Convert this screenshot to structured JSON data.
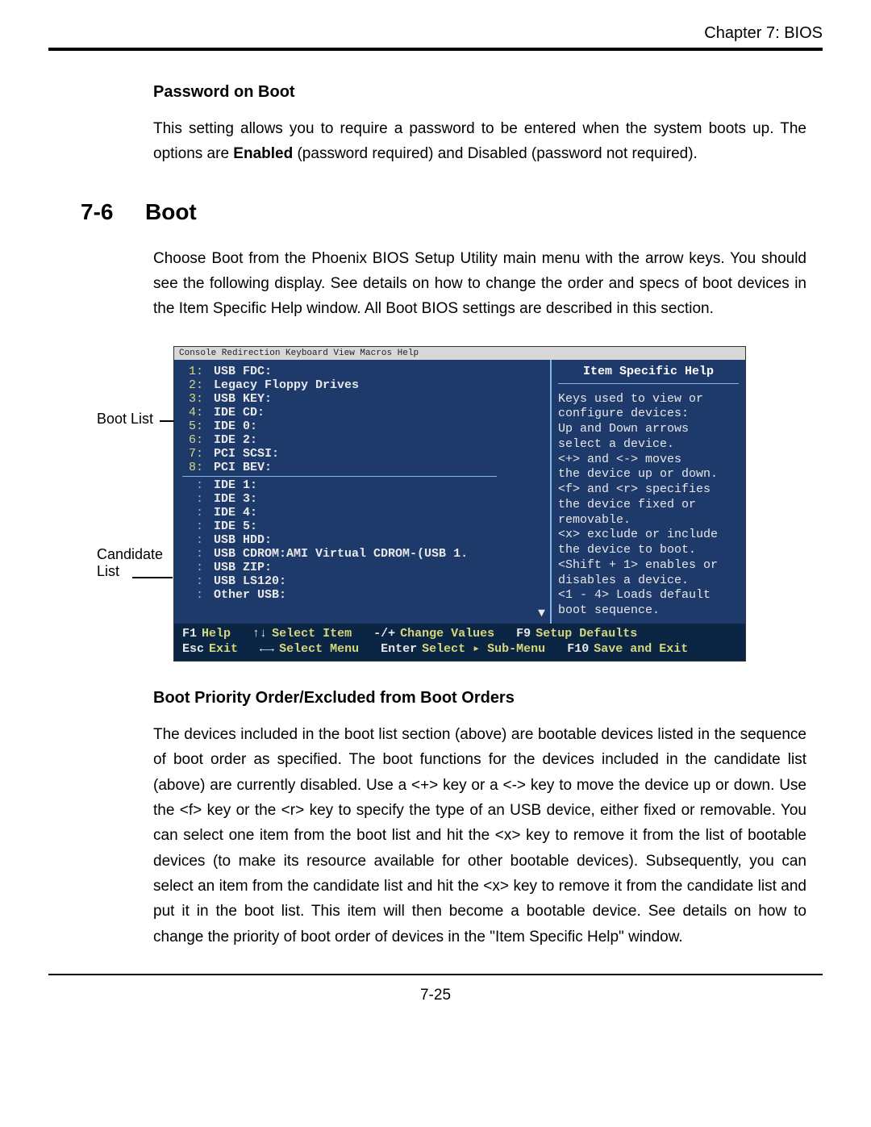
{
  "header": {
    "chapter_line": "Chapter 7: BIOS"
  },
  "sect1": {
    "heading": "Password on Boot",
    "p1a": "This setting allows you to require a password to be entered when the system boots up.  The options are ",
    "bold": "Enabled",
    "p1b": " (password required) and Disabled (password not required)."
  },
  "chapter": {
    "num": "7-6",
    "title": "Boot"
  },
  "intro": {
    "p": "Choose Boot from the Phoenix BIOS Setup Utility main menu with the arrow keys. You should see the following display.  See details on how to change the order and specs of boot devices in the Item Specific Help window.  All Boot BIOS settings are described in this section."
  },
  "labels": {
    "bootlist": "Boot List",
    "candidate_a": "Candidate",
    "candidate_b": "List"
  },
  "bios": {
    "menubar": "Console Redirection   Keyboard   View   Macros   Help",
    "boot_list": [
      {
        "n": "1:",
        "name": "USB FDC:"
      },
      {
        "n": "2:",
        "name": "Legacy Floppy Drives"
      },
      {
        "n": "3:",
        "name": "USB KEY:"
      },
      {
        "n": "4:",
        "name": "IDE CD:"
      },
      {
        "n": "5:",
        "name": "IDE 0:"
      },
      {
        "n": "6:",
        "name": "IDE 2:"
      },
      {
        "n": "7:",
        "name": "PCI SCSI:"
      },
      {
        "n": "8:",
        "name": "PCI BEV:"
      }
    ],
    "candidate_list": [
      {
        "n": ":",
        "name": "IDE 1:"
      },
      {
        "n": ":",
        "name": "IDE 3:"
      },
      {
        "n": ":",
        "name": "IDE 4:"
      },
      {
        "n": ":",
        "name": "IDE 5:"
      },
      {
        "n": ":",
        "name": "USB HDD:"
      },
      {
        "n": ":",
        "name": "USB CDROM:AMI Virtual CDROM-(USB 1."
      },
      {
        "n": ":",
        "name": "USB ZIP:"
      },
      {
        "n": ":",
        "name": "USB LS120:"
      },
      {
        "n": ":",
        "name": "Other USB:"
      }
    ],
    "help_title": "Item Specific Help",
    "help_lines": [
      "Keys used to view or",
      "configure devices:",
      "Up and Down arrows",
      "select a device.",
      "<+> and <-> moves",
      "the device up or down.",
      "<f> and <r> specifies",
      "the device fixed or",
      "removable.",
      "<x> exclude or include",
      "the device to boot.",
      "<Shift + 1> enables or",
      "disables a device.",
      "<1 - 4> Loads default",
      "boot sequence."
    ],
    "footer": {
      "f1k": "F1",
      "f1v": "Help",
      "upk": "↑↓",
      "upv": "Select Item",
      "pmk": "-/+",
      "pmv": "Change Values",
      "f9k": "F9",
      "f9v": "Setup Defaults",
      "esck": "Esc",
      "escv": "Exit",
      "lrk": "←→",
      "lrv": "Select Menu",
      "entk": "Enter",
      "entv": "Select ▸ Sub-Menu",
      "f10k": "F10",
      "f10v": "Save and Exit"
    }
  },
  "sect2": {
    "heading": "Boot Priority Order/Excluded from Boot Orders",
    "p": "The devices included in the boot list section (above) are bootable devices listed in the sequence of boot order as specified. The boot functions for the devices included in the candidate list (above) are currently disabled.  Use a <+> key or a <-> key to move the device up or down. Use the <f> key or the <r> key to specify the type of an USB device, either fixed or removable. You can select one item from the boot list and hit the <x> key to remove it from the list of bootable devices (to make its resource available for other bootable devices). Subsequently, you can select an item from the candidate list and hit the <x> key  to remove it from the candidate list and put it in the boot list. This item will then become a bootable device. See details on how to change the priority of boot order of devices in the \"Item Specific Help\" window."
  },
  "footer": {
    "page": "7-25"
  }
}
